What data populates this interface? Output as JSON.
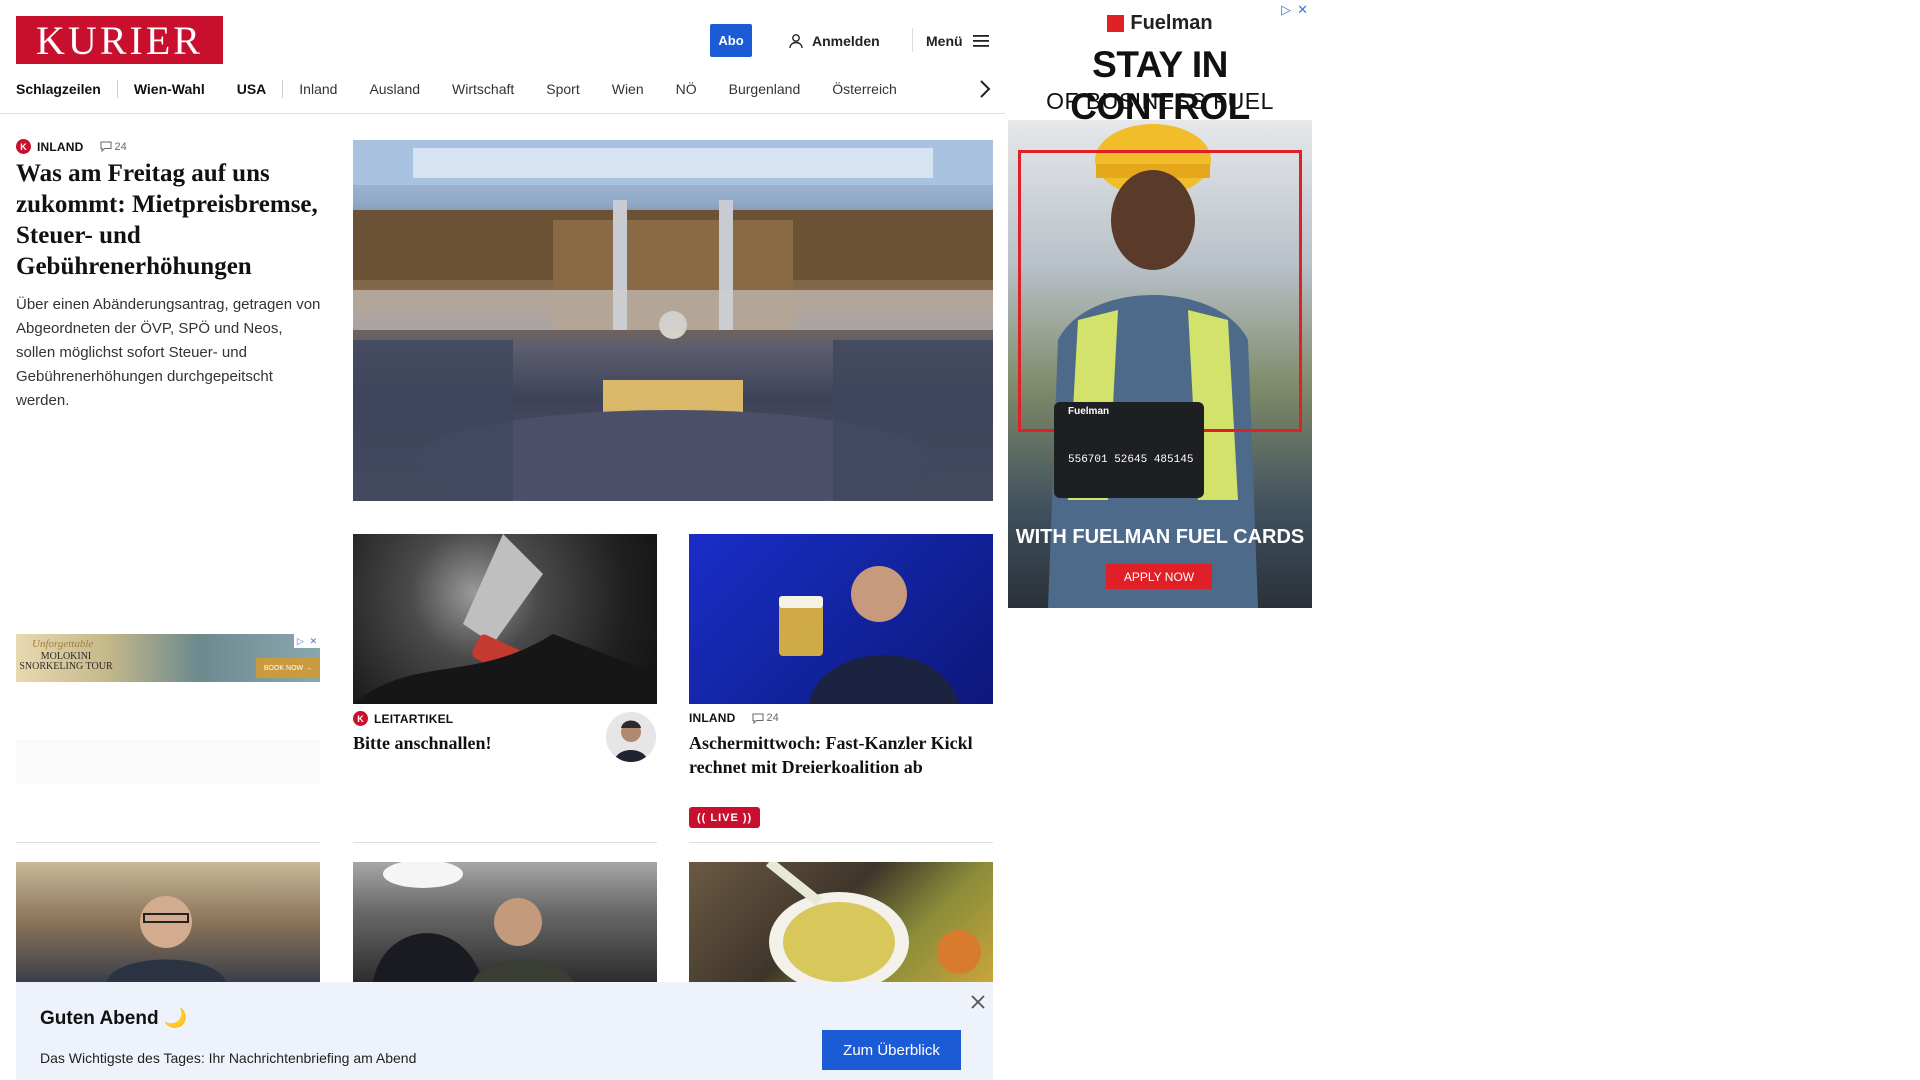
{
  "header": {
    "logo": "KURIER",
    "abo_label": "Abo",
    "login_label": "Anmelden",
    "menu_label": "Menü"
  },
  "nav": {
    "items": [
      "Schlagzeilen",
      "Wien-Wahl",
      "USA",
      "Inland",
      "Ausland",
      "Wirtschaft",
      "Sport",
      "Wien",
      "NÖ",
      "Burgenland",
      "Österreich"
    ]
  },
  "lead": {
    "badge": "K",
    "category": "INLAND",
    "comments": "24",
    "title": "Was am Freitag auf uns zukommt: Mietpreisbremse, Steuer- und Gebührenerhöhungen",
    "teaser": "Über einen Abänderungsantrag, getragen von Abgeordneten der ÖVP, SPÖ und Neos, sollen möglichst sofort Steuer- und Gebührenerhöhungen durchgepeitscht werden."
  },
  "cards": [
    {
      "badge": "K",
      "category": "LEITARTIKEL",
      "title": "Bitte anschnallen!"
    },
    {
      "category": "INLAND",
      "comments": "24",
      "title": "Aschermittwoch: Fast-Kanzler Kickl rechnet mit Dreierkoalition ab",
      "live": "(( LIVE ))"
    }
  ],
  "small_ad": {
    "tagline": "Unforgettable",
    "line1": "MOLOKINI",
    "line2": "SNORKELING TOUR",
    "cta": "BOOK NOW →"
  },
  "right_ad": {
    "brand": "Fuelman",
    "headline": "STAY IN CONTROL",
    "subheadline": "OF BUSINESS FUEL COSTS",
    "card_brand": "Fuelman",
    "card_number": "556701 52645 485145",
    "footer": "WITH FUELMAN FUEL CARDS",
    "cta": "APPLY NOW"
  },
  "banner": {
    "title": "Guten Abend 🌙",
    "subtitle": "Das Wichtigste des Tages: Ihr Nachrichtenbriefing am Abend",
    "button": "Zum Überblick"
  }
}
